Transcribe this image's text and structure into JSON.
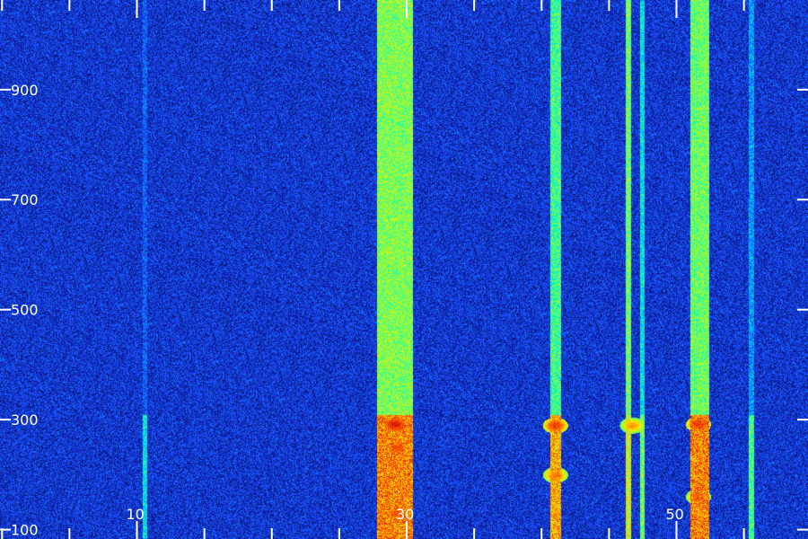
{
  "chart_data": {
    "type": "heatmap",
    "title": "",
    "xlabel": "",
    "ylabel": "",
    "x_ticks": [
      {
        "value": 10,
        "label": "10"
      },
      {
        "value": 30,
        "label": "30"
      },
      {
        "value": 50,
        "label": "50"
      }
    ],
    "x_minor_ticks": [
      0,
      5,
      10,
      15,
      20,
      25,
      30,
      35,
      40,
      45,
      50,
      55
    ],
    "xlim": [
      -0.15,
      59.75
    ],
    "y_ticks": [
      {
        "value": 100,
        "label": "100"
      },
      {
        "value": 300,
        "label": "300"
      },
      {
        "value": 500,
        "label": "500"
      },
      {
        "value": 700,
        "label": "700"
      },
      {
        "value": 900,
        "label": "900"
      }
    ],
    "ylim": [
      83,
      1063
    ],
    "background_level": 0.2,
    "colormap": [
      "#000030",
      "#0a1a8c",
      "#1e46ff",
      "#00b4ff",
      "#00ffc8",
      "#8cff3c",
      "#ffe600",
      "#ff6400",
      "#c80000"
    ],
    "bands": [
      {
        "x_start": 27.8,
        "x_end": 30.4,
        "level": 0.62,
        "low_level": 0.85,
        "low_top": 310
      },
      {
        "x_start": 40.6,
        "x_end": 41.4,
        "level": 0.55,
        "low_level": 0.8,
        "low_top": 310
      },
      {
        "x_start": 46.2,
        "x_end": 46.6,
        "level": 0.6,
        "low_level": 0.7,
        "low_top": 310
      },
      {
        "x_start": 47.3,
        "x_end": 47.6,
        "level": 0.45,
        "low_level": 0.6,
        "low_top": 310
      },
      {
        "x_start": 51.0,
        "x_end": 52.4,
        "level": 0.6,
        "low_level": 0.85,
        "low_top": 310
      },
      {
        "x_start": 55.3,
        "x_end": 55.7,
        "level": 0.35,
        "low_level": 0.55,
        "low_top": 310
      },
      {
        "x_start": 10.4,
        "x_end": 10.7,
        "level": 0.25,
        "low_level": 0.45,
        "low_top": 310
      }
    ],
    "hotspots": [
      {
        "x": 29.1,
        "y": 292,
        "level": 0.97
      },
      {
        "x": 29.3,
        "y": 250,
        "level": 0.9
      },
      {
        "x": 29.2,
        "y": 130,
        "level": 0.88
      },
      {
        "x": 41.0,
        "y": 290,
        "level": 0.92
      },
      {
        "x": 41.0,
        "y": 200,
        "level": 0.85
      },
      {
        "x": 51.6,
        "y": 292,
        "level": 0.92
      },
      {
        "x": 51.6,
        "y": 160,
        "level": 0.86
      },
      {
        "x": 46.7,
        "y": 290,
        "level": 0.82
      }
    ]
  }
}
